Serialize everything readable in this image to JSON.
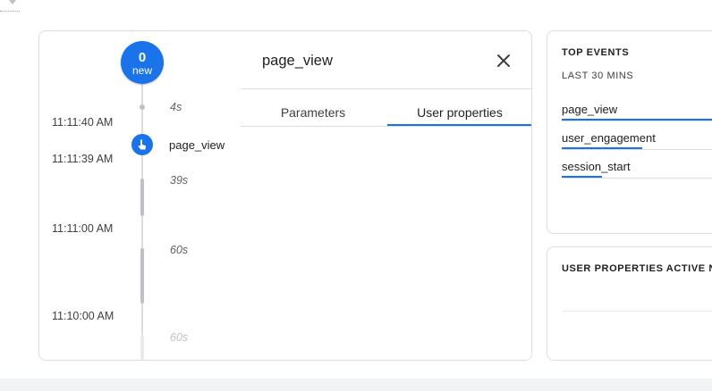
{
  "stream": {
    "new_count": "0",
    "new_label": "new",
    "timestamps": [
      "11:11:40 AM",
      "11:11:39 AM",
      "11:11:00 AM",
      "11:10:00 AM"
    ],
    "gaps": [
      "4s",
      "39s",
      "60s",
      "60s"
    ],
    "event": {
      "name": "page_view",
      "icon": "touch-icon"
    }
  },
  "detail": {
    "title": "page_view",
    "close_icon": "close-icon",
    "tabs": [
      "Parameters",
      "User properties"
    ],
    "active_tab": "User properties"
  },
  "top_events": {
    "heading": "TOP EVENTS",
    "subheading": "LAST 30 MINS",
    "items": [
      {
        "label": "page_view",
        "share": 1.0
      },
      {
        "label": "user_engagement",
        "share": 0.5
      },
      {
        "label": "session_start",
        "share": 0.25
      }
    ]
  },
  "user_properties": {
    "heading": "USER PROPERTIES ACTIVE NOW"
  },
  "colors": {
    "accent": "#1a73e8",
    "border": "#dadce0",
    "timeline": "#bdc1c6"
  }
}
